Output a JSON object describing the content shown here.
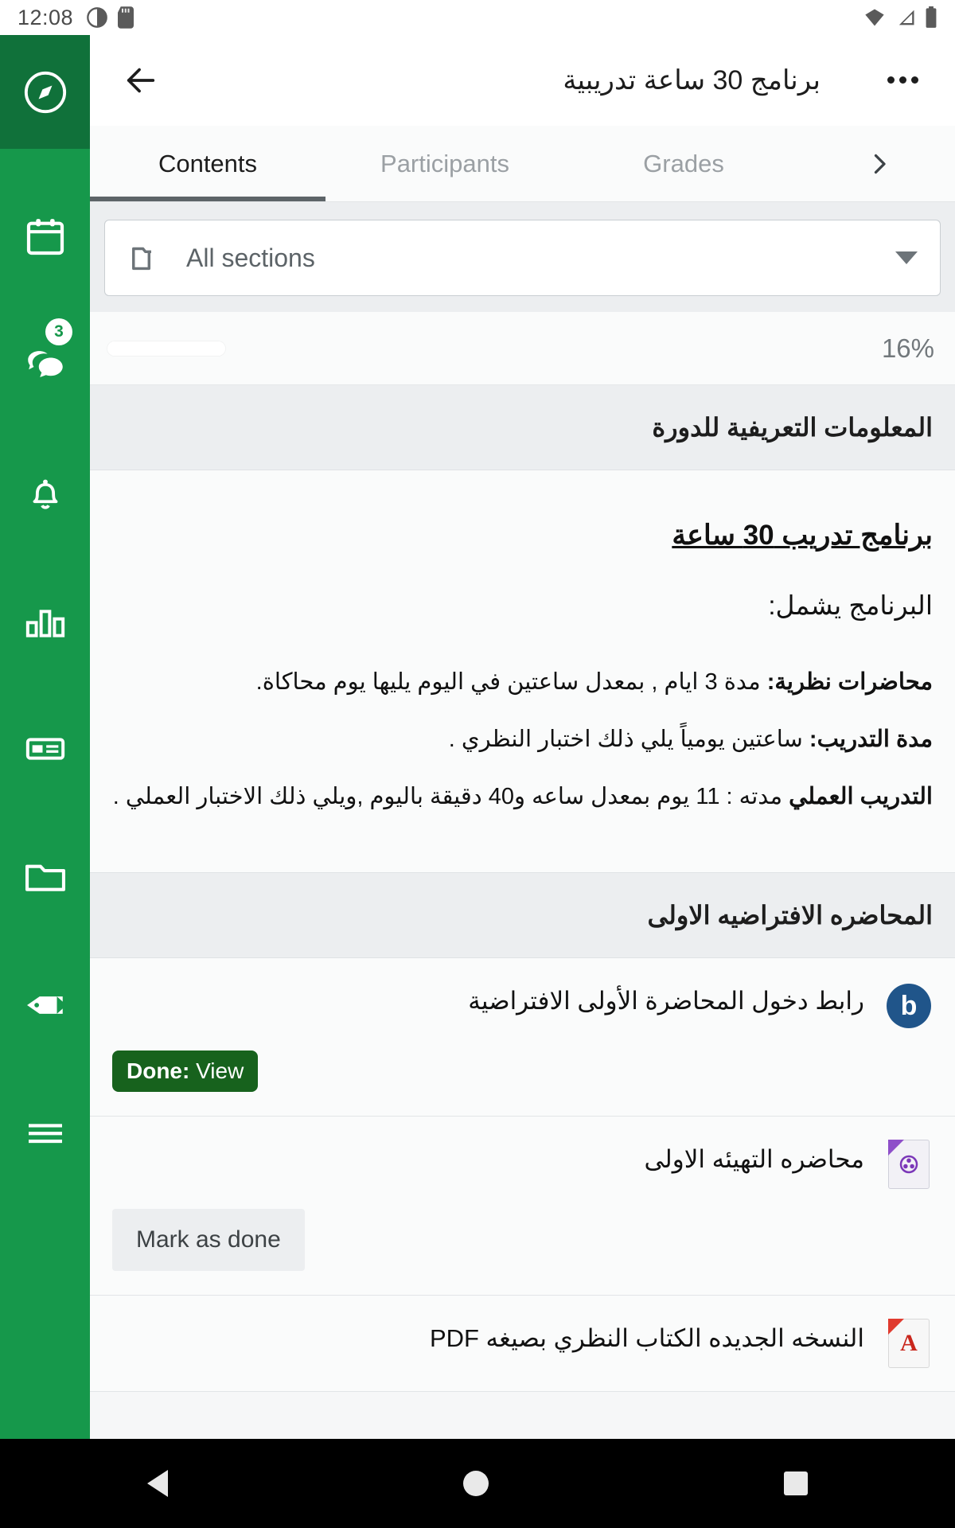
{
  "statusbar": {
    "time": "12:08",
    "left_icons": [
      "screenshot-icon",
      "sd-card-icon"
    ],
    "right_icons": [
      "wifi-icon",
      "signal-icon",
      "battery-icon"
    ]
  },
  "sidebar": {
    "background_color": "#16984b",
    "active_background_color": "#10713a",
    "items": [
      {
        "name": "site-home",
        "icon": "compass-icon",
        "active": true,
        "badge": ""
      },
      {
        "name": "calendar",
        "icon": "calendar-icon",
        "active": false,
        "badge": ""
      },
      {
        "name": "messages",
        "icon": "chat-bubbles-icon",
        "active": false,
        "badge": "3"
      },
      {
        "name": "notifications",
        "icon": "bell-icon",
        "active": false,
        "badge": ""
      },
      {
        "name": "grades",
        "icon": "bar-chart-icon",
        "active": false,
        "badge": ""
      },
      {
        "name": "news",
        "icon": "id-card-icon",
        "active": false,
        "badge": ""
      },
      {
        "name": "files",
        "icon": "folder-icon",
        "active": false,
        "badge": ""
      },
      {
        "name": "tags",
        "icon": "tag-icon",
        "active": false,
        "badge": ""
      },
      {
        "name": "more-menu",
        "icon": "hamburger-icon",
        "active": false,
        "badge": ""
      }
    ]
  },
  "appbar": {
    "back_icon": "arrow-left-icon",
    "title": "برنامج 30 ساعة تدريبية",
    "more_icon": "more-options-icon"
  },
  "tabs": {
    "items": [
      {
        "label": "Contents",
        "active": true
      },
      {
        "label": "Participants",
        "active": false
      },
      {
        "label": "Grades",
        "active": false
      }
    ],
    "overflow_icon": "chevron-right-icon"
  },
  "section_filter": {
    "icon": "folder-icon",
    "value": "All sections",
    "caret_icon": "chevron-down-icon"
  },
  "progress": {
    "percent_label": "16%",
    "percent_value": 16
  },
  "sections": [
    {
      "title": "المعلومات التعريفية للدورة",
      "document": {
        "heading": "برنامج تدريب 30 ساعة",
        "intro": "البرنامج يشمل:",
        "lines": [
          {
            "label": "محاضرات نظرية:",
            "text": " مدة 3 ايام , بمعدل ساعتين في اليوم يليها يوم محاكاة."
          },
          {
            "label": "مدة التدريب:",
            "text": " ساعتين يومياً يلي ذلك اختبار النظري ."
          },
          {
            "label": "التدريب العملي",
            "text": " مدته : 11 يوم بمعدل ساعه و40 دقيقة باليوم ,ويلي ذلك الاختبار العملي ."
          }
        ]
      },
      "activities": []
    },
    {
      "title": "المحاضره الافتراضيه الاولى",
      "activities": [
        {
          "icon": "bigbluebutton-icon",
          "icon_letter": "b",
          "name": "رابط دخول المحاضرة الأولى الافتراضية",
          "completion_type": "done-badge",
          "completion_prefix": "Done:",
          "completion_label": " View",
          "completion_color": "#17621d"
        },
        {
          "icon": "video-file-icon",
          "name": "محاضره التهيئه الاولى",
          "completion_type": "button",
          "completion_label": "Mark as done"
        },
        {
          "icon": "pdf-file-icon",
          "name": "النسخه الجديده الكتاب النظري بصيغه PDF",
          "completion_type": "none",
          "completion_label": ""
        }
      ]
    }
  ],
  "navbar": {
    "back": "nav-back-icon",
    "home": "nav-home-icon",
    "recents": "nav-recents-icon"
  }
}
